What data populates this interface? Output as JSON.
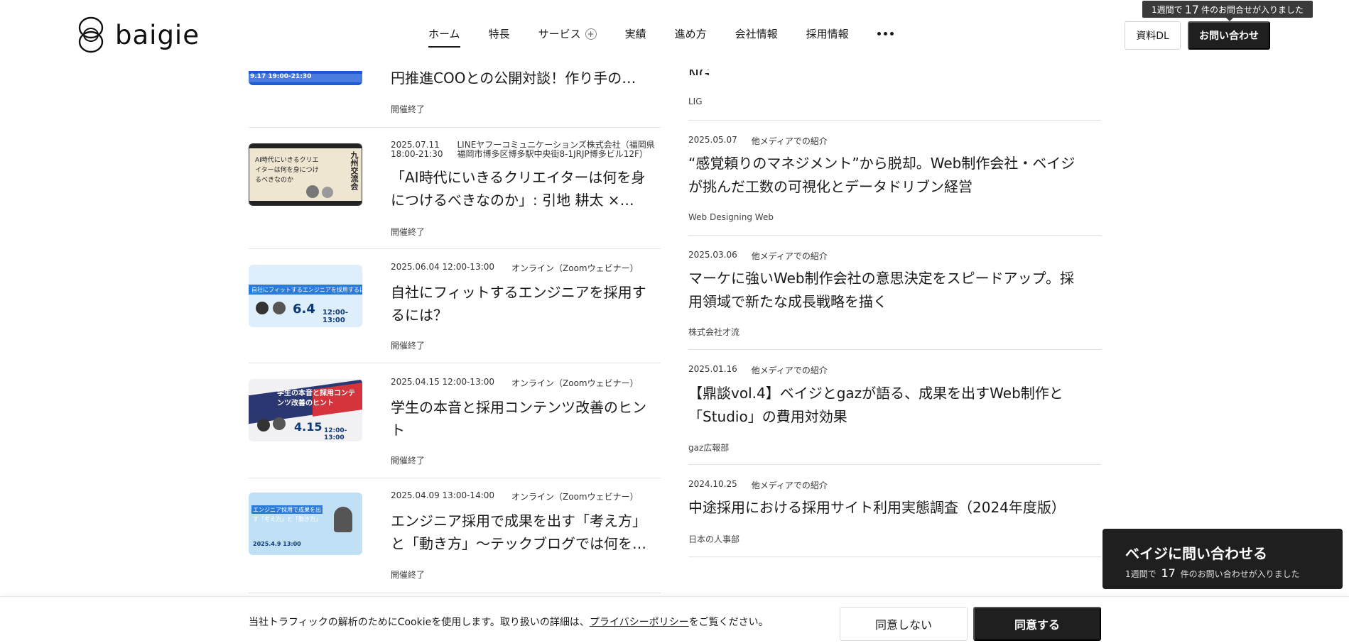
{
  "header": {
    "logo_text": "baigie",
    "nav": [
      {
        "label": "ホーム",
        "active": true
      },
      {
        "label": "特長"
      },
      {
        "label": "サービス",
        "has_plus": true
      },
      {
        "label": "実績"
      },
      {
        "label": "進め方"
      },
      {
        "label": "会社情報"
      },
      {
        "label": "採用情報"
      }
    ],
    "btn_dl": "資料DL",
    "btn_contact": "お問い合わせ",
    "badge": {
      "prefix": "1週間で",
      "count": "17",
      "suffix": "件のお問合せが入りました"
    }
  },
  "events": [
    {
      "date": "",
      "location": "",
      "title": "円推進COOとの公開対談！作り手のモ…",
      "status": "開催終了",
      "thumb_text": "9.17 19:00-21:30"
    },
    {
      "date": "2025.07.11",
      "time": "18:00-21:30",
      "location": "LINEヤフーコミュニケーションズ株式会社（福岡県福岡市博多区博多駅中央街8-1JRJP博多ビル12F）",
      "title": "「AI時代にいきるクリエイターは何を身につけるべきなのか」: 引地 耕太 × 枌…",
      "status": "開催終了",
      "thumb_text": "AI時代にいきるクリエイターは何を身につけるべきなのか",
      "thumb_badge": "九州交流会"
    },
    {
      "date": "2025.06.04 12:00-13:00",
      "location": "オンライン（Zoomウェビナー）",
      "title": "自社にフィットするエンジニアを採用するには？",
      "status": "開催終了",
      "thumb_text": "自社にフィットするエンジニアを採用するには？",
      "thumb_date": "6.4",
      "thumb_time": "12:00-13:00"
    },
    {
      "date": "2025.04.15 12:00-13:00",
      "location": "オンライン（Zoomウェビナー）",
      "title": "学生の本音と採用コンテンツ改善のヒント",
      "status": "開催終了",
      "thumb_text": "学生の本音と採用コンテンツ改善のヒント",
      "thumb_date": "4.15",
      "thumb_time": "12:00-13:00"
    },
    {
      "date": "2025.04.09 13:00-14:00",
      "location": "オンライン（Zoomウェビナー）",
      "title": "エンジニア採用で成果を出す「考え方」と「動き方」～テックブログでは何を…",
      "status": "開催終了",
      "thumb_text": "エンジニア採用で成果を出す「考え方」と「動き方」",
      "thumb_date": "2025.4.9 13:00"
    }
  ],
  "media": [
    {
      "date": "",
      "category": "",
      "title": "NG",
      "source": "LIG"
    },
    {
      "date": "2025.05.07",
      "category": "他メディアでの紹介",
      "title": "“感覚頼りのマネジメント”から脱却。Web制作会社・ベイジが挑んだ工数の可視化とデータドリブン経営",
      "source": "Web Designing Web"
    },
    {
      "date": "2025.03.06",
      "category": "他メディアでの紹介",
      "title": "マーケに強いWeb制作会社の意思決定をスピードアップ。採用領域で新たな成長戦略を描く",
      "source": "株式会社才流"
    },
    {
      "date": "2025.01.16",
      "category": "他メディアでの紹介",
      "title": "【鼎談vol.4】ベイジとgazが語る、成果を出すWeb制作と「Studio」の費用対効果",
      "source": "gaz広報部"
    },
    {
      "date": "2024.10.25",
      "category": "他メディアでの紹介",
      "title": "中途採用における採用サイト利用実態調査（2024年度版）",
      "source": "日本の人事部"
    }
  ],
  "float_contact": {
    "title": "ベイジに問い合わせる",
    "prefix": "1週間で",
    "count": "17",
    "suffix": "件のお問い合わせが入りました"
  },
  "cookie": {
    "text_before": "当社トラフィックの解析のためにCookieを使用します。取り扱いの詳細は、",
    "link": "プライバシーポリシー",
    "text_after": "をご覧ください。",
    "decline": "同意しない",
    "accept": "同意する"
  },
  "colors": {
    "dark": "#1f1f1f",
    "border": "#e2e2e2",
    "accent_blue": "#1d5bd6",
    "accent_red": "#d6343d"
  }
}
